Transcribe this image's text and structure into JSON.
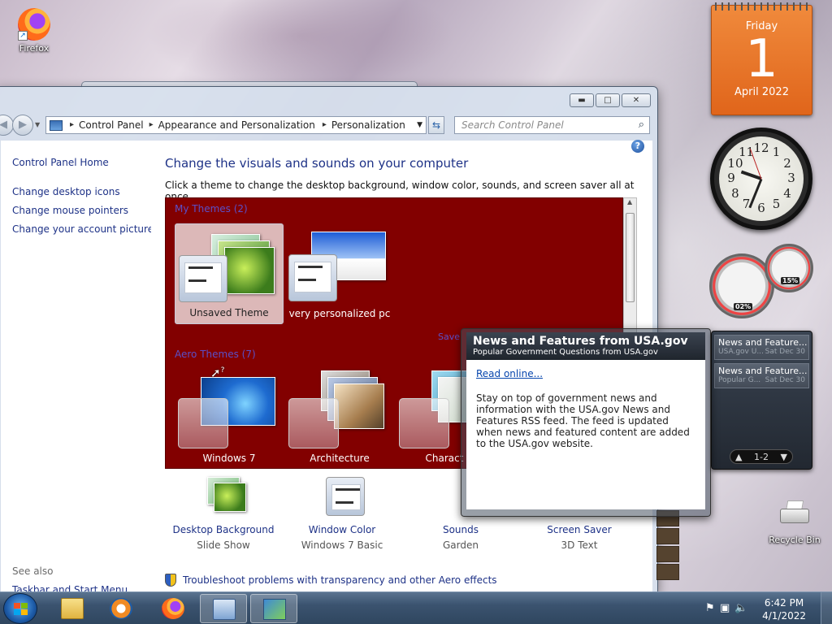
{
  "desktop": {
    "icons": [
      {
        "label": "Firefox",
        "icon": "firefox-icon"
      },
      {
        "label": "Recycle Bin",
        "icon": "recycle-bin-icon"
      }
    ]
  },
  "calendar": {
    "weekday": "Friday",
    "day": "1",
    "month_year": "April 2022"
  },
  "clock": {
    "numbers": [
      "12",
      "1",
      "2",
      "3",
      "4",
      "5",
      "6",
      "7",
      "8",
      "9",
      "10",
      "11"
    ]
  },
  "meter": {
    "cpu": "02%",
    "memory": "15%"
  },
  "feed_gadget": {
    "items": [
      {
        "title": "News and Feature...",
        "source": "USA.gov U...",
        "date": "Sat Dec 30"
      },
      {
        "title": "News and Feature...",
        "source": "Popular G...",
        "date": "Sat Dec 30"
      }
    ],
    "pager": "1-2"
  },
  "flyout": {
    "title": "News and Features from USA.gov",
    "subtitle": "Popular Government Questions from USA.gov",
    "link": "Read online...",
    "body": "Stay on top of government news and information with the USA.gov News and Features RSS feed. The feed is updated when news and featured content are added to the USA.gov website."
  },
  "window": {
    "address": {
      "crumbs": [
        "Control Panel",
        "Appearance and Personalization",
        "Personalization"
      ]
    },
    "search_placeholder": "Search Control Panel",
    "sidebar": {
      "home": "Control Panel Home",
      "links": [
        "Change desktop icons",
        "Change mouse pointers",
        "Change your account picture"
      ],
      "see_also": "See also",
      "see_also_links": [
        "Taskbar and Start Menu"
      ]
    },
    "heading": "Change the visuals and sounds on your computer",
    "subheading": "Click a theme to change the desktop background, window color, sounds, and screen saver all at once.",
    "my_themes_label": "My Themes (2)",
    "save_theme": "Save",
    "aero_themes_label": "Aero Themes (7)",
    "my_themes": [
      "Unsaved Theme",
      "very personalized pc"
    ],
    "aero_themes": [
      "Windows 7",
      "Architecture",
      "Charact"
    ],
    "options": [
      {
        "label": "Desktop Background",
        "value": "Slide Show"
      },
      {
        "label": "Window Color",
        "value": "Windows 7 Basic"
      },
      {
        "label": "Sounds",
        "value": "Garden"
      },
      {
        "label": "Screen Saver",
        "value": "3D Text"
      }
    ],
    "troubleshoot": "Troubleshoot problems with transparency and other Aero effects"
  },
  "taskbar": {
    "pinned": [
      "explorer-icon",
      "media-player-icon",
      "firefox-icon",
      "control-panel-icon",
      "personalization-icon"
    ],
    "time": "6:42 PM",
    "date": "4/1/2022"
  },
  "colors": {
    "themes_bg": "#820000",
    "link": "#1e3287",
    "calendar": "#e0651b"
  }
}
